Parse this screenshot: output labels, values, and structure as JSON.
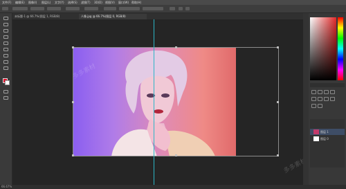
{
  "menu": {
    "items": [
      "文件(F)",
      "编辑(E)",
      "图像(I)",
      "图层(L)",
      "文字(Y)",
      "选择(S)",
      "滤镜(T)",
      "3D(D)",
      "视图(V)",
      "窗口(W)",
      "帮助(H)"
    ]
  },
  "tabs": [
    {
      "label": "未标题-1 @ 66.7%(图层 1, RGB/8)"
    },
    {
      "label": "人像.jpg @ 66.7%(图层 0, RGB/8)"
    }
  ],
  "status": {
    "zoom": "66.67%"
  },
  "layers": [
    {
      "name": "图层 1"
    },
    {
      "name": "图层 0"
    }
  ],
  "watermarks": [
    "多多素材",
    "多多素材"
  ],
  "colors": {
    "guide": "#2bb6c7",
    "foreground": "#e0102a",
    "background": "#ffffff"
  }
}
